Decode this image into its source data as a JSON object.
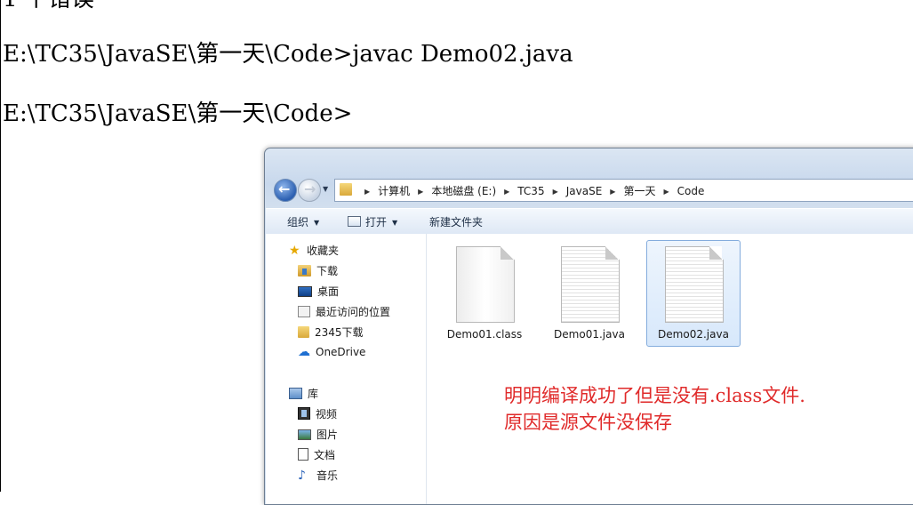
{
  "console": {
    "line0": "1 个错误",
    "line1": "E:\\TC35\\JavaSE\\第一天\\Code>javac Demo02.java",
    "line2": "E:\\TC35\\JavaSE\\第一天\\Code>"
  },
  "explorer": {
    "breadcrumbs": [
      "计算机",
      "本地磁盘 (E:)",
      "TC35",
      "JavaSE",
      "第一天",
      "Code"
    ],
    "toolbar": {
      "organize": "组织",
      "open": "打开",
      "new_folder": "新建文件夹"
    },
    "nav": {
      "favorites": "收藏夹",
      "downloads": "下载",
      "desktop": "桌面",
      "recent": "最近访问的位置",
      "downloads_2345": "2345下载",
      "onedrive": "OneDrive",
      "libraries": "库",
      "videos": "视频",
      "pictures": "图片",
      "documents": "文档",
      "music": "音乐"
    },
    "files": [
      {
        "name": "Demo01.class",
        "icon": "blank-file-icon",
        "selected": false
      },
      {
        "name": "Demo01.java",
        "icon": "text-file-icon",
        "selected": false
      },
      {
        "name": "Demo02.java",
        "icon": "text-file-icon",
        "selected": true
      }
    ]
  },
  "annotation": {
    "line1": "明明编译成功了但是没有.class文件.",
    "line2": "原因是源文件没保存"
  },
  "colors": {
    "annotation": "#e02a2a",
    "selection": "#d7e8fb"
  }
}
